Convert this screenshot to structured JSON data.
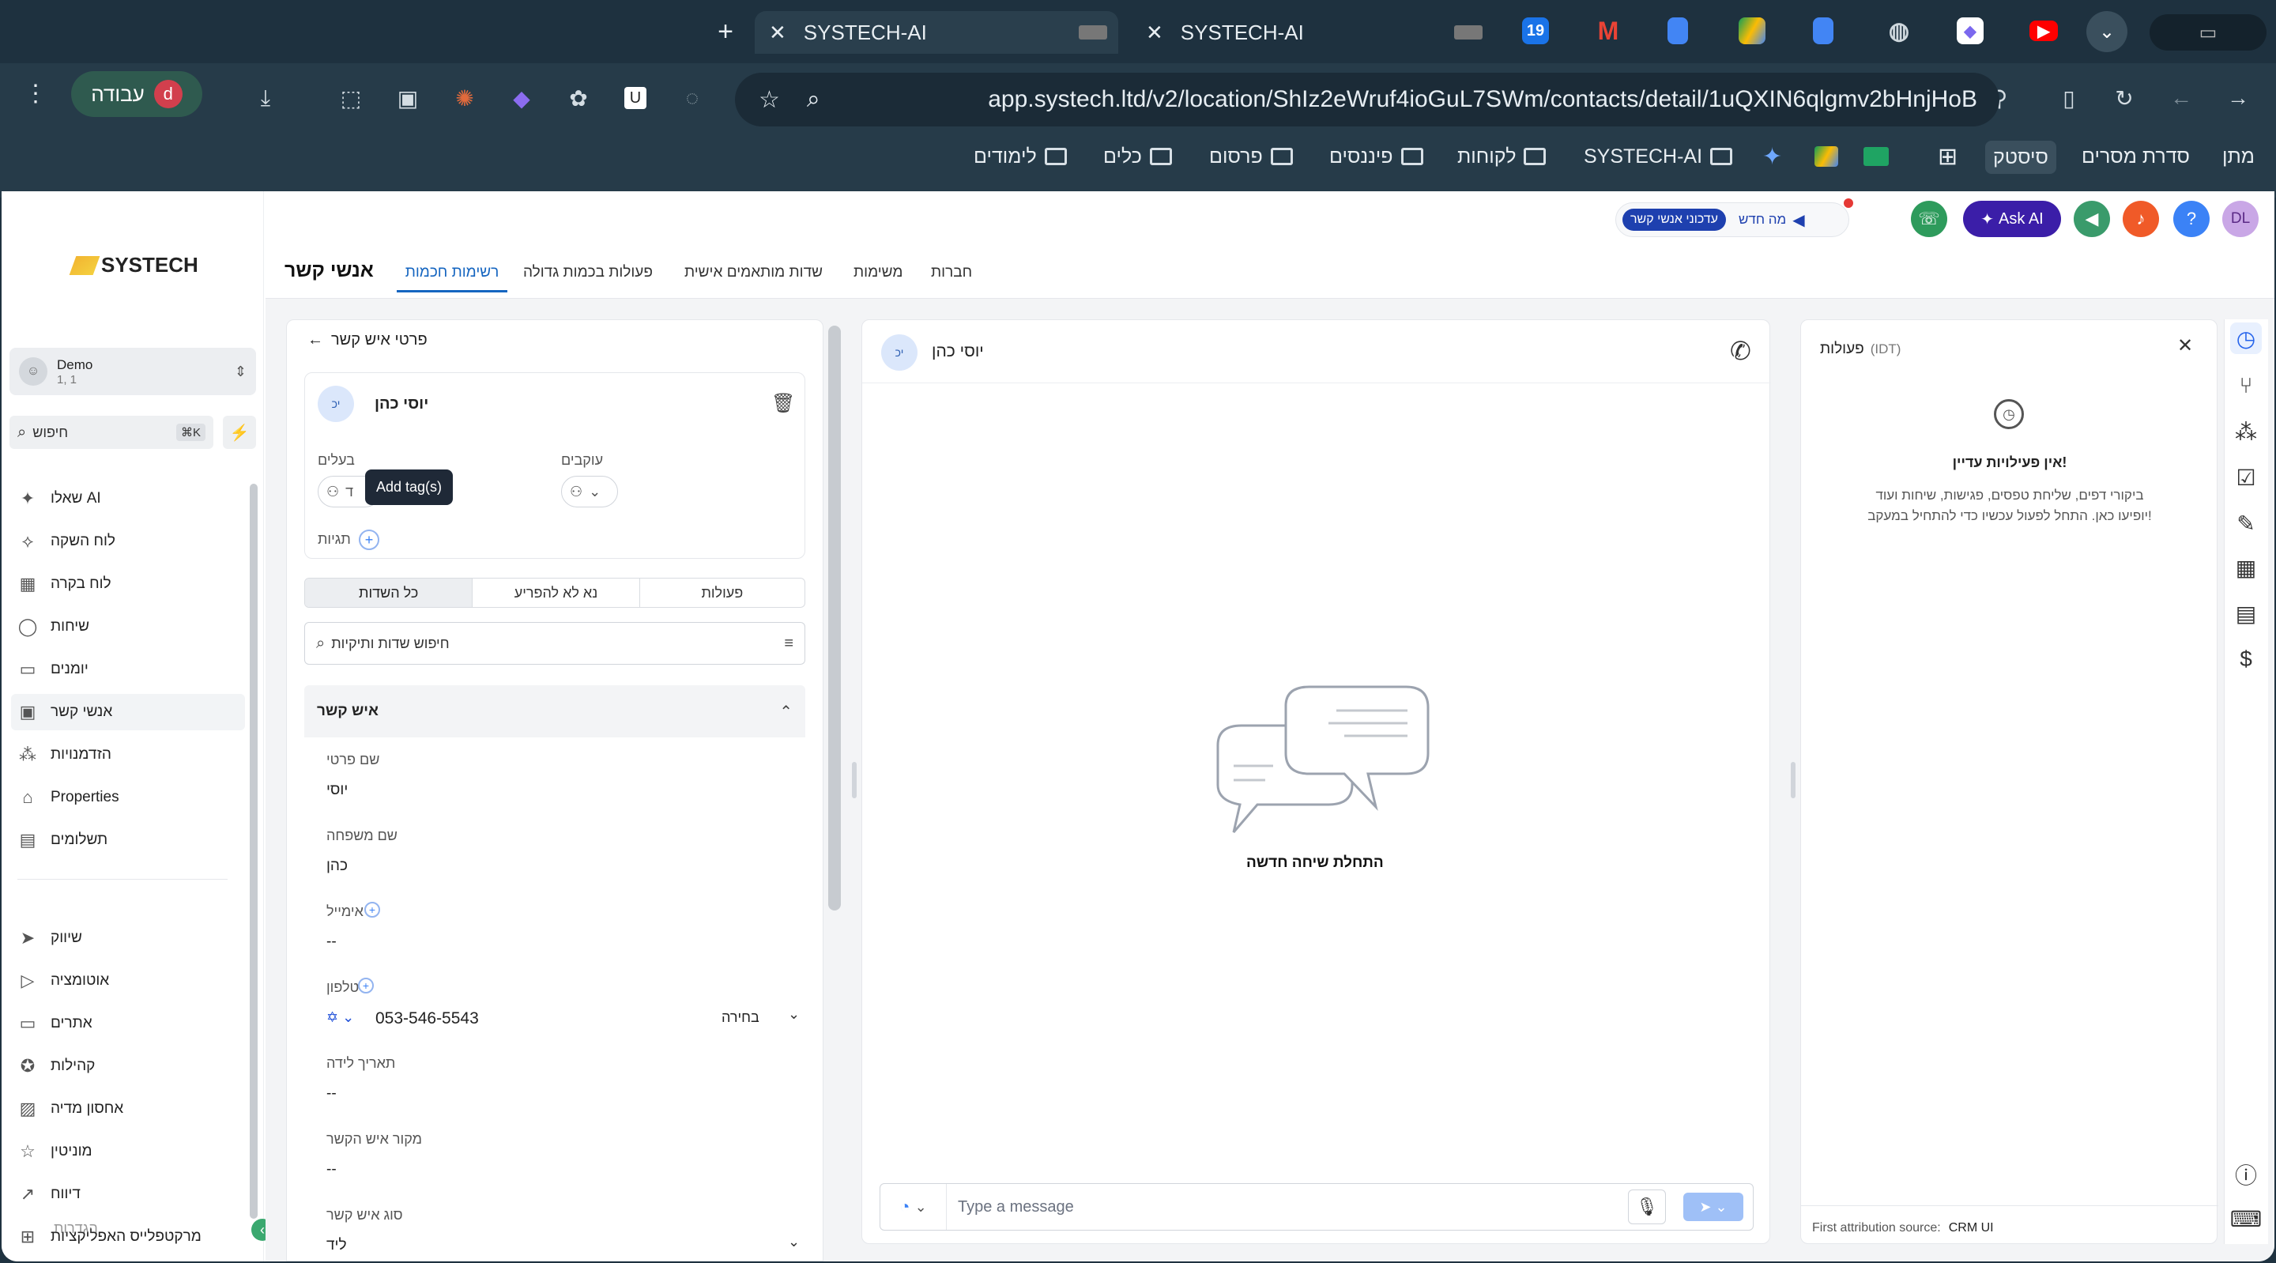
{
  "browser": {
    "tabs": [
      {
        "title": "SYSTECH-AI",
        "active": true
      },
      {
        "title": "SYSTECH-AI",
        "active": false
      }
    ],
    "new_tab": "+",
    "url": "app.systech.ltd/v2/location/ShIz2eWruf4ioGuL7SWm/contacts/detail/1uQXIN6qlgmv2bHnjHoB",
    "profile_label": "עבודה",
    "profile_initial": "d",
    "ext_u": "U",
    "pin_cal": "19",
    "pin_m": "M",
    "bookmarks": [
      "מתן",
      "סדרת מסרים",
      "סיסטק",
      "SYSTECH-AI",
      "לקוחות",
      "פיננסים",
      "פרסום",
      "כלים",
      "לימודים"
    ]
  },
  "header": {
    "logo": "SYSTECH",
    "page_title": "אנשי קשר",
    "tabs": [
      "רשימות חכמות",
      "פעולות בכמות גדולה",
      "שדות מותאמים אישית",
      "משימות",
      "חברות"
    ],
    "news_label": "מה חדש",
    "news_pill": "עדכוני אנשי קשר",
    "ask_ai": "Ask AI",
    "help": "?",
    "avatar": "DL"
  },
  "sidebar": {
    "account_name": "Demo",
    "account_sub": "1, 1",
    "search_placeholder": "חיפוש",
    "search_shortcut": "⌘K",
    "items": [
      {
        "label": "שאלו AI",
        "icon": "sparkle-icon"
      },
      {
        "label": "לוח השקה",
        "icon": "rocket-icon"
      },
      {
        "label": "לוח בקרה",
        "icon": "dashboard-icon"
      },
      {
        "label": "שיחות",
        "icon": "chat-icon"
      },
      {
        "label": "יומנים",
        "icon": "calendar-icon"
      },
      {
        "label": "אנשי קשר",
        "icon": "contacts-icon",
        "selected": true
      },
      {
        "label": "הזדמנויות",
        "icon": "opportunities-icon"
      },
      {
        "label": "Properties",
        "icon": "home-icon"
      },
      {
        "label": "תשלומים",
        "icon": "payments-icon"
      }
    ],
    "items2": [
      {
        "label": "שיווק",
        "icon": "send-icon"
      },
      {
        "label": "אוטומציה",
        "icon": "automation-icon"
      },
      {
        "label": "אתרים",
        "icon": "sites-icon"
      },
      {
        "label": "קהילות",
        "icon": "award-icon"
      },
      {
        "label": "אחסון מדיה",
        "icon": "media-icon"
      },
      {
        "label": "מוניטין",
        "icon": "star-icon"
      },
      {
        "label": "דיווח",
        "icon": "chart-icon"
      },
      {
        "label": "מרקטפלייס האפליקציות",
        "icon": "grid-icon"
      }
    ],
    "overlap_label": "הגדרות"
  },
  "contact": {
    "back_label": "פרטי איש קשר",
    "name": "יוסי כהן",
    "initials": "יכ",
    "owner_label": "בעלים",
    "followers_label": "עוקבים",
    "owner_value": "ד",
    "tooltip": "Add tag(s)",
    "tags_label": "תגיות",
    "tabs": [
      "כל השדות",
      "נא לא להפריע",
      "פעולות"
    ],
    "search_placeholder": "חיפוש שדות ותיקיות",
    "section_title": "איש קשר",
    "fields": [
      {
        "label": "שם פרטי",
        "value": "יוסי"
      },
      {
        "label": "שם משפחה",
        "value": "כהן"
      },
      {
        "label": "אימייל",
        "value": "--"
      },
      {
        "label": "טלפון",
        "value": "053-546-5543"
      },
      {
        "label": "תאריך לידה",
        "value": "--"
      },
      {
        "label": "מקור איש הקשר",
        "value": "--"
      },
      {
        "label": "סוג איש קשר",
        "value": "ליד"
      }
    ],
    "phone_type": "בחירה"
  },
  "conversation": {
    "name": "יוסי כהן",
    "initials": "יכ",
    "empty_title": "התחלת שיחה חדשה",
    "message_placeholder": "Type a message"
  },
  "activity": {
    "title": "פעולות",
    "tz": "(IDT)",
    "empty_title": "אין פעילויות עדיין!",
    "empty_line1": "ביקורי דפים, שליחת טפסים, פגישות, שיחות ועוד",
    "empty_line2": "יופיעו כאן. התחל לפעול עכשיו כדי להתחיל במעקב!",
    "attribution_label": "First attribution source:",
    "attribution_value": "CRM UI"
  }
}
